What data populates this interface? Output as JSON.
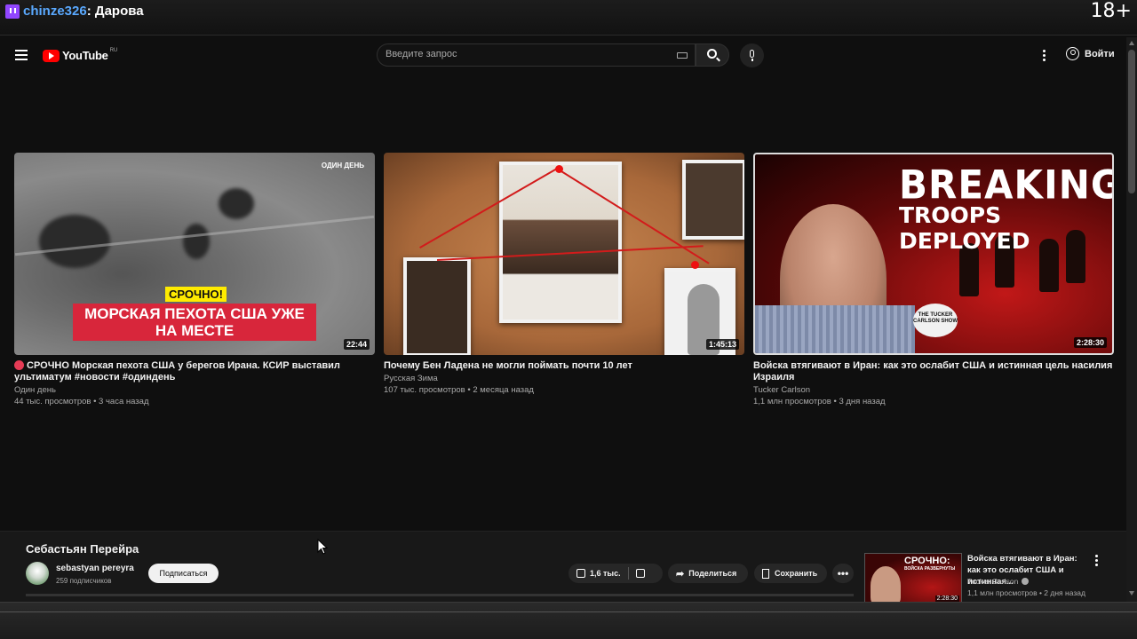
{
  "stream_overlay": {
    "chat_user": "chinze326",
    "chat_separator": ":",
    "chat_message": "Дарова",
    "age_rating": "18+"
  },
  "masthead": {
    "logo_text": "YouTube",
    "logo_region": "RU",
    "search_placeholder": "Введите запрос",
    "signin_label": "Войти"
  },
  "videos": [
    {
      "title": "СРОЧНО Морская пехота США у берегов Ирана. КСИР выставил ультиматум #новости #одиндень",
      "channel": "Один день",
      "meta": "44 тыс. просмотров • 3 часа назад",
      "duration": "22:44",
      "thumb_brand": "ОДИН ДЕНЬ",
      "thumb_tag": "СРОЧНО!",
      "thumb_headline": "МОРСКАЯ ПЕХОТА США УЖЕ НА МЕСТЕ"
    },
    {
      "title": "Почему Бен Ладена не могли поймать почти 10 лет",
      "channel": "Русская Зима",
      "meta": "107 тыс. просмотров • 2 месяца назад",
      "duration": "1:45:13"
    },
    {
      "title": "Войска втягивают в Иран: как это ослабит США и истинная цель насилия Израиля",
      "channel": "Tucker Carlson",
      "meta": "1,1 млн просмотров • 3 дня назад",
      "duration": "2:28:30",
      "thumb_line1": "BREAKING:",
      "thumb_line2": "TROOPS DEPLOYED",
      "thumb_badge": "THE TUCKER CARLSON SHOW"
    }
  ],
  "watch": {
    "title": "Себастьян Перейра",
    "channel_name": "sebastyan pereyra",
    "subscribers": "259 подписчиков",
    "subscribe_label": "Подписаться",
    "likes": "1,6 тыс.",
    "share_label": "Поделиться",
    "save_label": "Сохранить",
    "more_label": "•••"
  },
  "next_video": {
    "title": "Войска втягивают в Иран: как это ослабит США и истинная...",
    "channel": "Tucker Carlson",
    "meta": "1,1 млн просмотров • 2 дня назад",
    "thumb_line1": "СРОЧНО:",
    "thumb_line2": "ВОЙСКА РАЗВЕРНУТЫ",
    "duration": "2:28:30"
  },
  "colors": {
    "background": "#0f0f0f",
    "accent_red": "#ff0000",
    "twitch": "#9146ff",
    "chat_user": "#5aa9ff"
  }
}
